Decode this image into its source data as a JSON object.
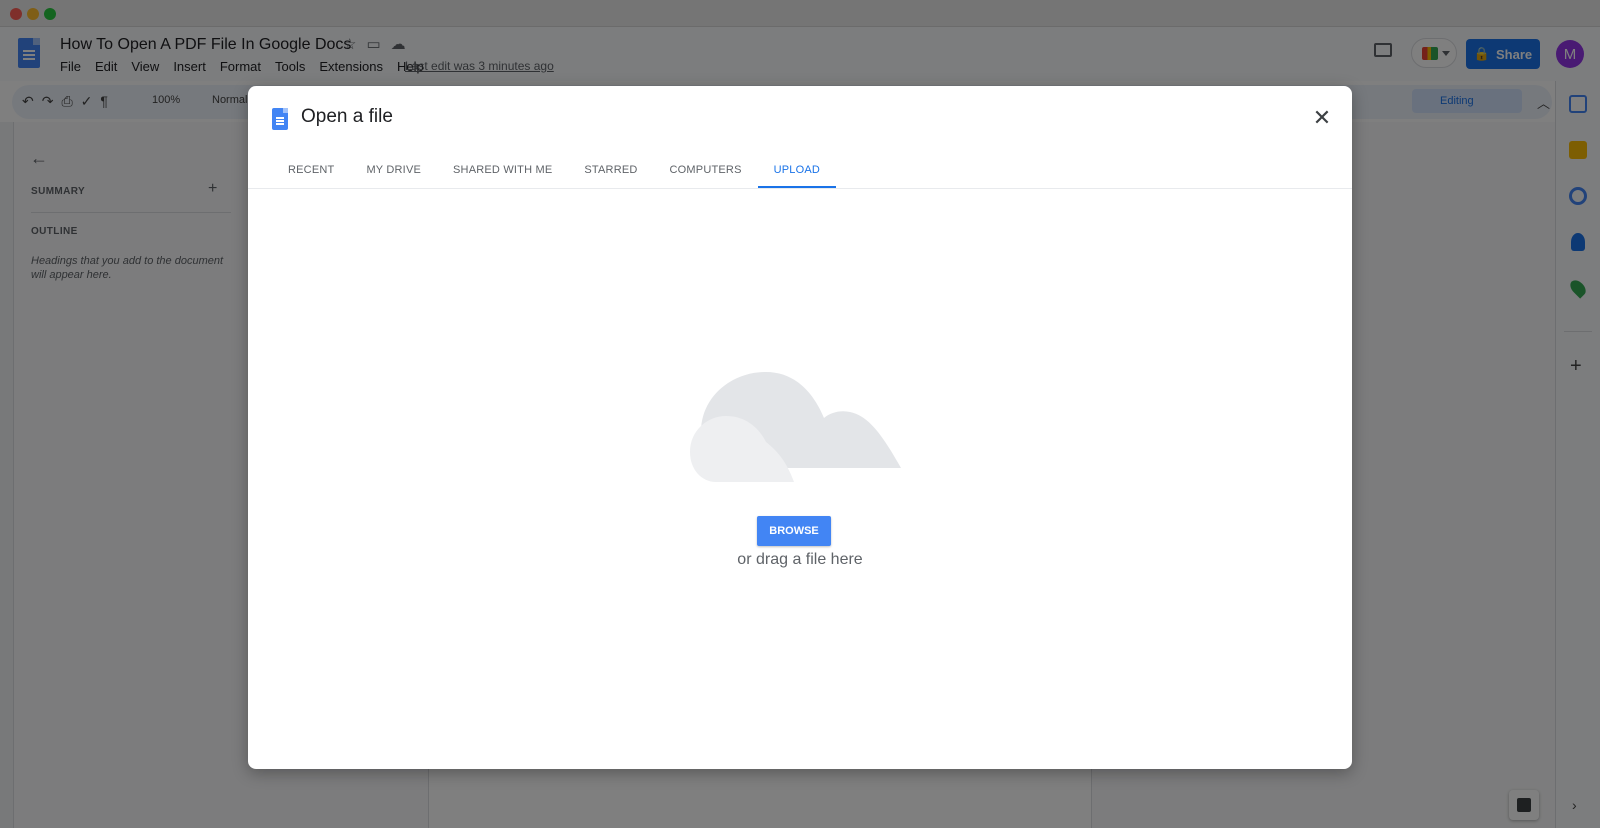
{
  "doc": {
    "title": "How To Open A PDF File In Google Docs",
    "menu": [
      "File",
      "Edit",
      "View",
      "Insert",
      "Format",
      "Tools",
      "Extensions",
      "Help"
    ],
    "last_edit": "Last edit was 3 minutes ago",
    "share_label": "Share",
    "avatar_initial": "M"
  },
  "toolbar": {
    "zoom": "100%",
    "style": "Normal",
    "mode": "Editing"
  },
  "outline": {
    "summary_label": "SUMMARY",
    "outline_label": "OUTLINE",
    "hint": "Headings that you add to the document will appear here."
  },
  "dialog": {
    "title": "Open a file",
    "tabs": [
      "RECENT",
      "MY DRIVE",
      "SHARED WITH ME",
      "STARRED",
      "COMPUTERS",
      "UPLOAD"
    ],
    "active_tab": "UPLOAD",
    "browse_label": "BROWSE",
    "drag_text": "or drag a file here"
  },
  "colors": {
    "accent": "#1a73e8",
    "browse": "#4285f4",
    "overlay": "rgba(0,0,0,0.5)"
  },
  "icons": [
    "docs-logo-icon",
    "star-icon",
    "move-folder-icon",
    "cloud-status-icon",
    "comment-icon",
    "meet-icon",
    "lock-icon",
    "close-icon",
    "cloud-illustration-icon"
  ]
}
